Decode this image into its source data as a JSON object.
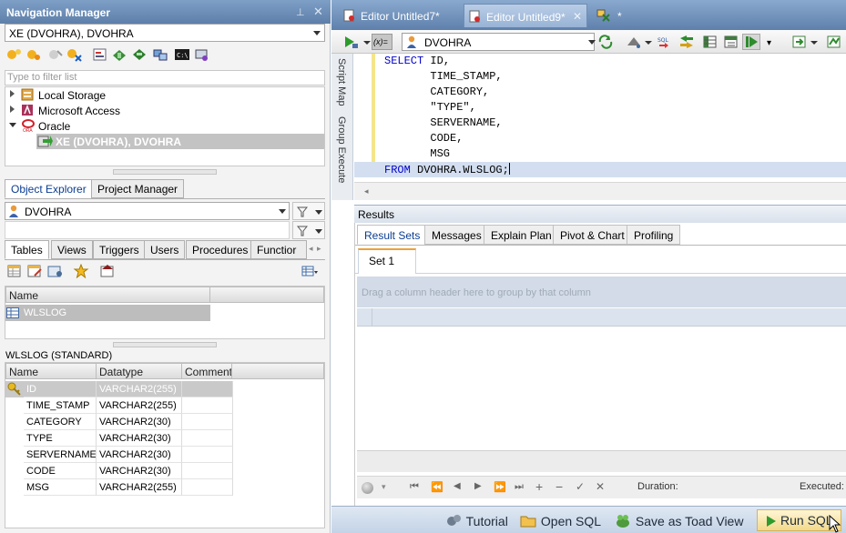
{
  "nav": {
    "title": "Navigation Manager",
    "connection_value": "XE (DVOHRA), DVOHRA",
    "filter_placeholder": "Type to filter list",
    "tree": [
      {
        "label": "Local Storage"
      },
      {
        "label": "Microsoft Access"
      },
      {
        "label": "Oracle"
      },
      {
        "label": "XE (DVOHRA), DVOHRA"
      }
    ],
    "bottom_tabs": [
      "Object Explorer",
      "Project Manager"
    ],
    "schema_value": "DVOHRA",
    "object_tabs": [
      "Tables",
      "Views",
      "Triggers",
      "Users",
      "Procedures",
      "Functior"
    ],
    "objects_header": "Name",
    "objects": [
      "WLSLOG"
    ],
    "details_title": "WLSLOG (STANDARD)",
    "columns_header": [
      "Name",
      "Datatype",
      "Comment"
    ],
    "columns": [
      {
        "name": "ID",
        "type": "VARCHAR2(255)"
      },
      {
        "name": "TIME_STAMP",
        "type": "VARCHAR2(255)"
      },
      {
        "name": "CATEGORY",
        "type": "VARCHAR2(30)"
      },
      {
        "name": "TYPE",
        "type": "VARCHAR2(30)"
      },
      {
        "name": "SERVERNAME",
        "type": "VARCHAR2(30)"
      },
      {
        "name": "CODE",
        "type": "VARCHAR2(30)"
      },
      {
        "name": "MSG",
        "type": "VARCHAR2(255)"
      }
    ]
  },
  "editor": {
    "tabs": [
      "Editor Untitled7*",
      "Editor Untitled9*",
      "*"
    ],
    "param_label": "(x)=",
    "connection": "DVOHRA",
    "side_tabs": [
      "Script Map",
      "Group Execute"
    ],
    "code": [
      {
        "kw": "SELECT",
        "rest": " ID,"
      },
      {
        "kw": "",
        "rest": "       TIME_STAMP,"
      },
      {
        "kw": "",
        "rest": "       CATEGORY,"
      },
      {
        "kw": "",
        "rest": "       \"TYPE\","
      },
      {
        "kw": "",
        "rest": "       SERVERNAME,"
      },
      {
        "kw": "",
        "rest": "       CODE,"
      },
      {
        "kw": "",
        "rest": "       MSG"
      },
      {
        "kw": "FROM",
        "rest": " DVOHRA.WLSLOG;"
      }
    ]
  },
  "results": {
    "title": "Results",
    "tabs": [
      "Result Sets",
      "Messages",
      "Explain Plan",
      "Pivot & Chart",
      "Profiling"
    ],
    "set_tab": "Set 1",
    "group_hint": "Drag a column header here to group by that column",
    "duration_label": "Duration:",
    "executed_label": "Executed:"
  },
  "statusbar": {
    "tutorial": "Tutorial",
    "open_sql": "Open SQL",
    "save_toad": "Save as Toad View",
    "run_sql": "Run SQL"
  }
}
